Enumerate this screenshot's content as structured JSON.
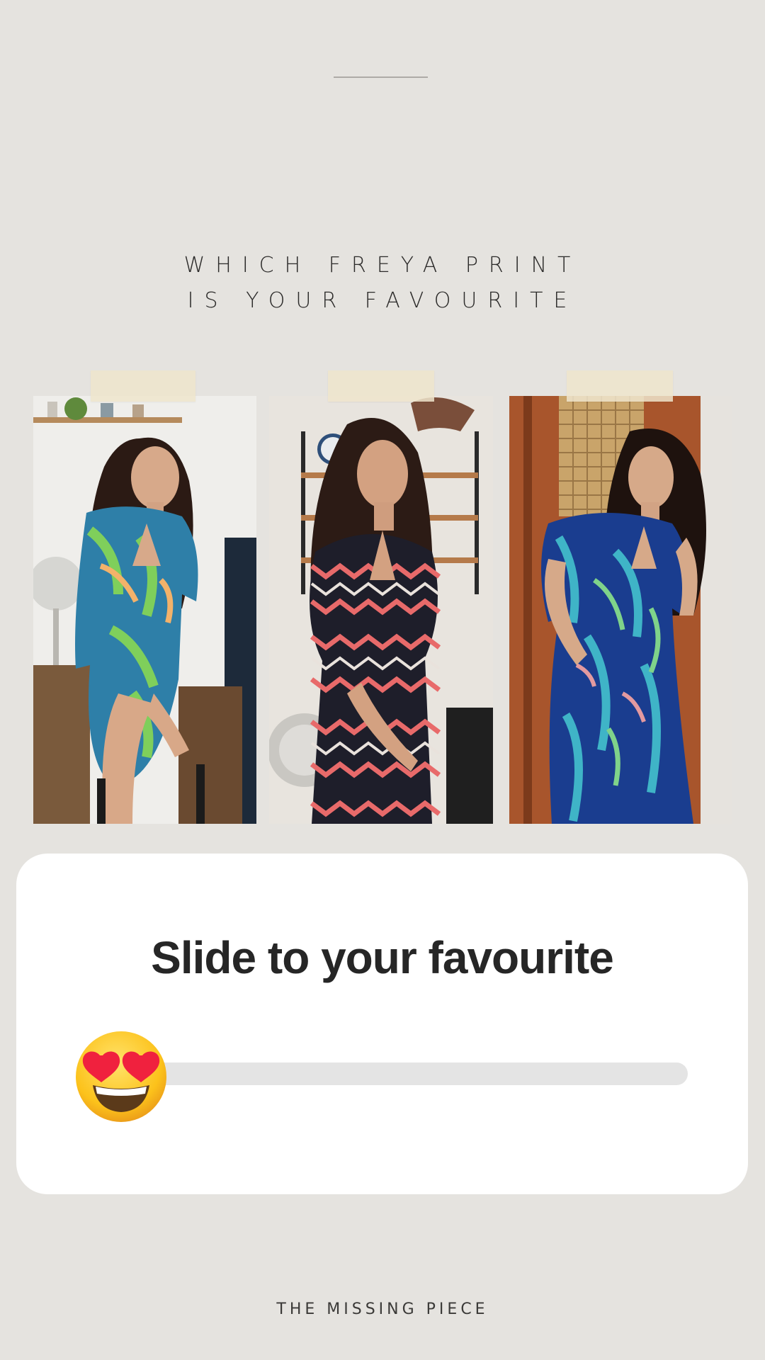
{
  "headline": {
    "line1": "WHICH FREYA PRINT",
    "line2": "IS YOUR FAVOURITE"
  },
  "photos": [
    {
      "dress": "green tropical leaf print",
      "bg": "#f0efec"
    },
    {
      "dress": "red and black chevron print",
      "bg": "#e6e2dc"
    },
    {
      "dress": "blue tropical leaf print",
      "bg": "#a4522a"
    }
  ],
  "poll": {
    "question": "Slide to your favourite",
    "emoji": "heart-eyes-emoji",
    "slider_value": 0
  },
  "footer": {
    "brand": "THE MISSING PIECE"
  },
  "colors": {
    "background": "#e5e3df",
    "card": "#ffffff",
    "track": "#e4e4e4"
  }
}
